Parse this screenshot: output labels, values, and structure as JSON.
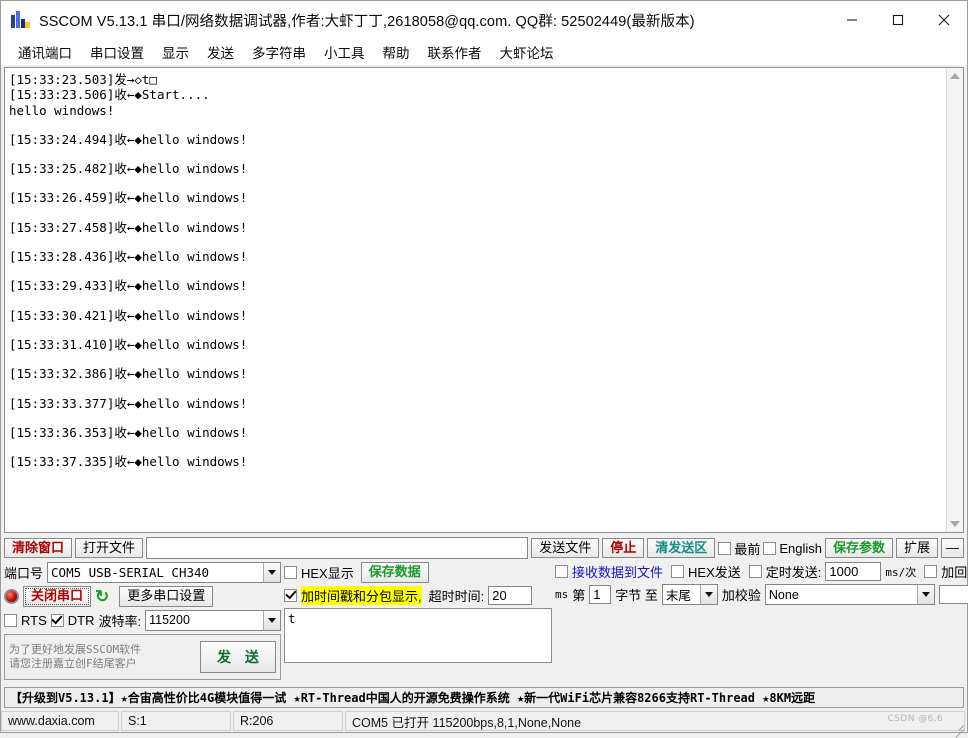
{
  "window": {
    "title": "SSCOM V5.13.1 串口/网络数据调试器,作者:大虾丁丁,2618058@qq.com. QQ群: 52502449(最新版本)",
    "minimize": "—",
    "maximize": "□",
    "close": "✕"
  },
  "menu": {
    "items": [
      {
        "label": "通讯端口"
      },
      {
        "label": "串口设置"
      },
      {
        "label": "显示"
      },
      {
        "label": "发送"
      },
      {
        "label": "多字符串"
      },
      {
        "label": "小工具"
      },
      {
        "label": "帮助"
      },
      {
        "label": "联系作者"
      },
      {
        "label": "大虾论坛"
      }
    ]
  },
  "terminal": {
    "lines": [
      {
        "text": "[15:33:23.503]发→◇t□",
        "gap": false
      },
      {
        "text": "[15:33:23.506]收←◆Start....",
        "gap": false
      },
      {
        "text": "hello windows!",
        "gap": false
      },
      {
        "text": "[15:33:24.494]收←◆hello windows!",
        "gap": true
      },
      {
        "text": "[15:33:25.482]收←◆hello windows!",
        "gap": true
      },
      {
        "text": "[15:33:26.459]收←◆hello windows!",
        "gap": true
      },
      {
        "text": "[15:33:27.458]收←◆hello windows!",
        "gap": true
      },
      {
        "text": "[15:33:28.436]收←◆hello windows!",
        "gap": true
      },
      {
        "text": "[15:33:29.433]收←◆hello windows!",
        "gap": true
      },
      {
        "text": "[15:33:30.421]收←◆hello windows!",
        "gap": true
      },
      {
        "text": "[15:33:31.410]收←◆hello windows!",
        "gap": true
      },
      {
        "text": "[15:33:32.386]收←◆hello windows!",
        "gap": true
      },
      {
        "text": "[15:33:33.377]收←◆hello windows!",
        "gap": true
      },
      {
        "text": "[15:33:36.353]收←◆hello windows!",
        "gap": true
      },
      {
        "text": "[15:33:37.335]收←◆hello windows!",
        "gap": true
      }
    ]
  },
  "toolbar": {
    "clear_window": "清除窗口",
    "open_file": "打开文件",
    "file_path": "",
    "file_path_placeholder": "",
    "send_file": "发送文件",
    "stop": "停止",
    "clear_send": "清发送区",
    "topmost": "最前",
    "topmost_checked": false,
    "english": "English",
    "english_checked": false,
    "save_params": "保存参数",
    "extend": "扩展",
    "collapse": "—"
  },
  "port": {
    "label": "端口号",
    "value": "COM5 USB-SERIAL CH340",
    "close_port": "关闭串口",
    "refresh_icon": "refresh-icon",
    "more_settings": "更多串口设置",
    "rts": "RTS",
    "rts_checked": false,
    "dtr": "DTR",
    "dtr_checked": true,
    "baud_label": "波特率:",
    "baud_value": "115200"
  },
  "promo": {
    "line1": "为了更好地发展SSCOM软件",
    "line2": "请您注册嘉立创F结尾客户",
    "send_button": "发 送"
  },
  "recv_options": {
    "hex_display": "HEX显示",
    "hex_display_checked": false,
    "save_data": "保存数据",
    "recv_to_file": "接收数据到文件",
    "recv_to_file_checked": false,
    "timestamp": "加时间戳和分包显示,",
    "timestamp_checked": true,
    "timeout_label": "超时时间:",
    "timeout_value": "20",
    "timeout_unit": "ms",
    "byte_prefix": "第",
    "byte_index": "1",
    "byte_mid": "字节 至",
    "byte_end": "末尾",
    "checksum_label": "加校验",
    "checksum_value": "None"
  },
  "send_options": {
    "hex_send": "HEX发送",
    "hex_send_checked": false,
    "timed_send": "定时发送:",
    "timed_send_checked": false,
    "interval_value": "1000",
    "interval_unit": "ms/次",
    "add_crlf": "加回车换行",
    "add_crlf_checked": false,
    "help": "?",
    "send_text": "t"
  },
  "adbar": {
    "text": "【升级到V5.13.1】★合宙高性价比4G模块值得一试 ★RT-Thread中国人的开源免费操作系统 ★新一代WiFi芯片兼容8266支持RT-Thread ★8KM远距"
  },
  "statusbar": {
    "website": "www.daxia.com",
    "sent": "S:1",
    "received": "R:206",
    "connection": "COM5 已打开  115200bps,8,1,None,None",
    "watermark": "CSDN @6,6"
  }
}
